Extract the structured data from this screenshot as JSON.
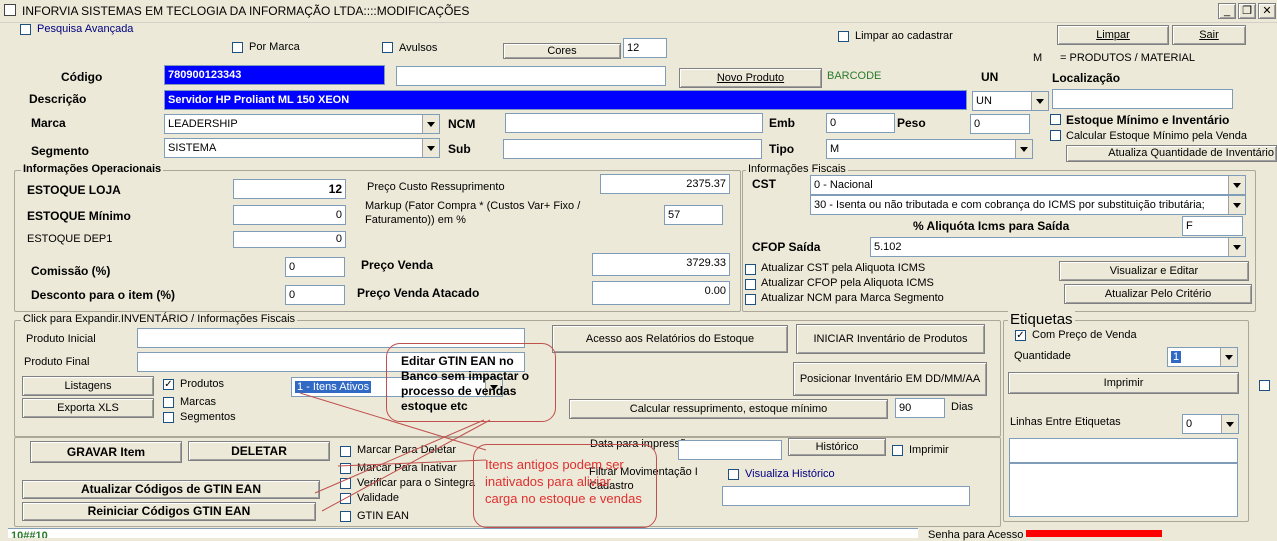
{
  "window": {
    "title": "INFORVIA SISTEMAS EM TECLOGIA DA INFORMAÇÃO LTDA::::MODIFICAÇÕES",
    "minimize": "_",
    "restore": "❐",
    "close": "✕"
  },
  "top": {
    "pesquisa_avancada": "Pesquisa Avançada",
    "por_marca": "Por Marca",
    "avulsos": "Avulsos",
    "cores_button": "Cores",
    "cores_value": "12",
    "limpar_ao_cadastrar": "Limpar ao cadastrar",
    "limpar_button": "Limpar",
    "sair_button": "Sair",
    "m_legend_m": "M",
    "m_legend_text": "= PRODUTOS / MATERIAL"
  },
  "product": {
    "codigo_label": "Código",
    "codigo_value": "780900123343",
    "codigo2_value": "",
    "novo_produto_button": "Novo Produto",
    "barcode_label": "BARCODE",
    "un_label": "UN",
    "localizacao_label": "Localização",
    "localizacao_value": "",
    "descricao_label": "Descrição",
    "descricao_value": "Servidor HP Proliant ML 150 XEON",
    "un_value": "UN",
    "marca_label": "Marca",
    "marca_value": "LEADERSHIP",
    "ncm_label": "NCM",
    "ncm_value": "",
    "emb_label": "Emb",
    "emb_value": "0",
    "peso_label": "Peso",
    "peso_value": "0",
    "estoque_min_inv": "Estoque Mínimo e Inventário",
    "calcular_estoque": "Calcular Estoque Mínimo pela Venda",
    "atualiza_qtd_button": "Atualiza Quantidade de Inventário",
    "segmento_label": "Segmento",
    "segmento_value": "SISTEMA",
    "sub_label": "Sub",
    "sub_value": "",
    "tipo_label": "Tipo",
    "tipo_value": "M"
  },
  "operacionais": {
    "title": "Informações Operacionais",
    "estoque_loja_label": "ESTOQUE LOJA",
    "estoque_loja_value": "12",
    "estoque_minimo_label": "ESTOQUE Mínimo",
    "estoque_minimo_value": "0",
    "estoque_dep1_label": "ESTOQUE DEP1",
    "estoque_dep1_value": "0",
    "comissao_label": "Comissão  (%)",
    "comissao_value": "0",
    "desconto_label": "Desconto para o item (%)",
    "desconto_value": "0",
    "preco_custo_label": "Preço Custo Ressuprimento",
    "preco_custo_value": "2375.37",
    "markup_label_1": "Markup (Fator Compra *  (Custos Var+ Fixo /",
    "markup_label_2": "Faturamento))  em %",
    "markup_value": "57",
    "preco_venda_label": "Preço Venda",
    "preco_venda_value": "3729.33",
    "preco_atacado_label": "Preço Venda Atacado",
    "preco_atacado_value": "0.00"
  },
  "fiscais": {
    "title": "Informações Fiscais",
    "cst_label": "CST",
    "cst_value": "0 - Nacional",
    "cst2_value": "30 - Isenta ou não tributada e com cobrança do ICMS por substituição tributária;",
    "aliquota_label": "% Aliquóta Icms para Saída",
    "aliquota_value": "F",
    "cfop_label": "CFOP Saída",
    "cfop_value": "5.102",
    "atualizar_cst": "Atualizar CST pela Aliquota ICMS",
    "atualizar_cfop": "Atualizar CFOP pela Aliquota ICMS",
    "atualizar_ncm": "Atualizar NCM para Marca Segmento",
    "visualizar_button": "Visualizar e Editar",
    "atualizar_criterio_button": "Atualizar Pelo Critério"
  },
  "inventario": {
    "title": "Click para Expandir.INVENTÁRIO / Informações Fiscais",
    "produto_inicial": "Produto Inicial",
    "produto_final": "Produto Final",
    "listagens_button": "Listagens",
    "exporta_button": "Exporta XLS",
    "produtos": "Produtos",
    "marcas": "Marcas",
    "segmentos": "Segmentos",
    "itens_ativos": "1 - Itens Ativos",
    "acesso_button": "Acesso aos Relatórios do Estoque",
    "iniciar_button": "INICIAR Inventário de Produtos",
    "posicionar_button": "Posicionar Inventário EM DD/MM/AA",
    "calcular_button": "Calcular ressuprimento, estoque mínimo",
    "dias_value": "90",
    "dias_label": "Dias"
  },
  "etiquetas": {
    "title": "Etiquetas",
    "com_preco": "Com  Preço de Venda",
    "quantidade_label": "Quantidade",
    "quantidade_value": "1",
    "imprimir_button": "Imprimir",
    "linhas_label": "Linhas Entre Etiquetas",
    "linhas_value": "0"
  },
  "bottom": {
    "gravar_button": "GRAVAR Item",
    "deletar_button": "DELETAR",
    "marcar_deletar": "Marcar Para Deletar",
    "marcar_inativar": "Marcar Para Inativar",
    "verificar_sintegra": "Verificar para o Sintegra",
    "validade": "Validade",
    "gtin_ean": "GTIN EAN",
    "atualizar_gtin_button": "Atualizar Códigos de GTIN EAN",
    "reiniciar_gtin_button": "Reiniciar Códigos GTIN EAN",
    "data_impressao": "Data para impressão",
    "historico_button": "Histórico",
    "imprimir": "Imprimir",
    "filtrar_mov": "Filtrar Movimentação I",
    "cadastro": "Cadastro",
    "visualiza_historico": "Visualiza Histórico",
    "status_text": "10##10",
    "senha_label": "Senha para Acesso"
  },
  "annotations": {
    "callout1": "Editar GTIN EAN no Banco sem impactar o processo de vendas estoque etc",
    "callout2": "Itens antigos podem ser inativados para aliviar carga no estoque e vendas"
  },
  "colors": {
    "highlight_blue": "#0000ff",
    "callout_red": "#c0504d",
    "callout_text": "#e03030",
    "barcode_green": "#2a7a2a",
    "senha_red": "#ff0000"
  }
}
